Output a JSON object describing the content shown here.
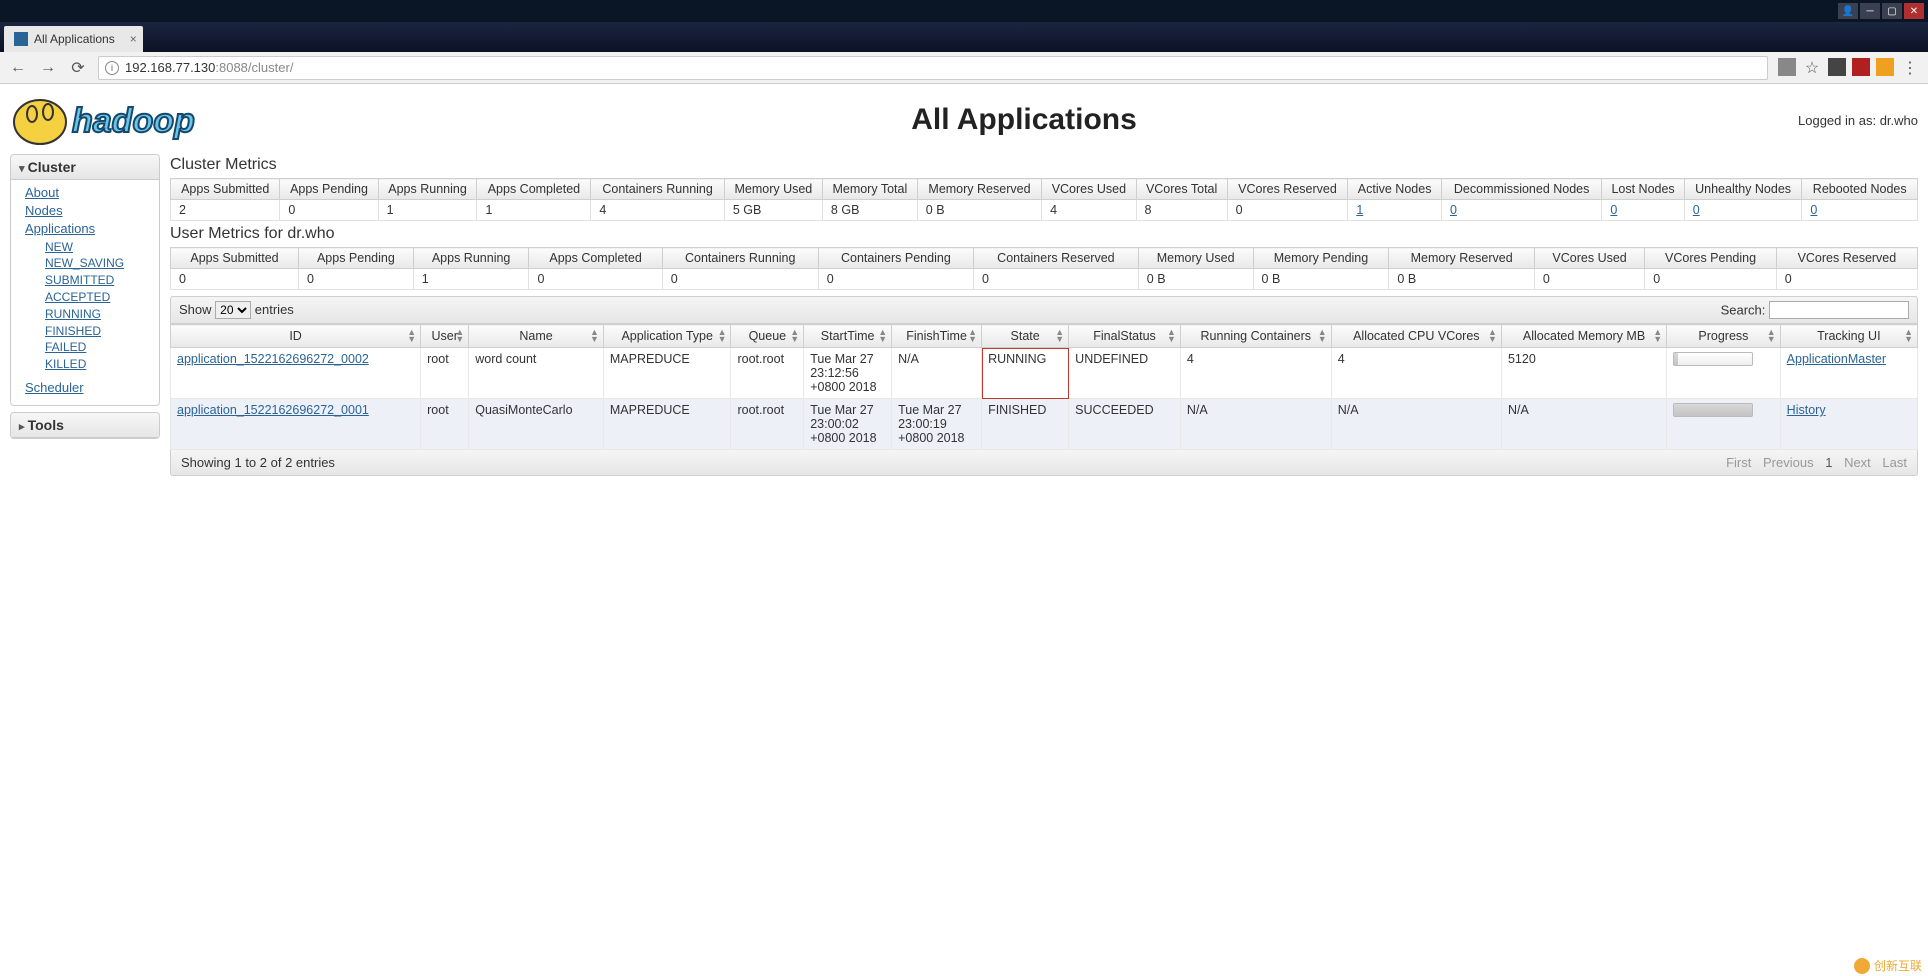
{
  "window": {
    "title": "All Applications"
  },
  "browser": {
    "tab_title": "All Applications",
    "url_host": "192.168.77.130",
    "url_port": ":8088",
    "url_path": "/cluster/"
  },
  "header": {
    "logo_text": "hadoop",
    "page_title": "All Applications",
    "logged_in_label": "Logged in as: ",
    "logged_in_user": "dr.who"
  },
  "sidebar": {
    "cluster": {
      "title": "Cluster",
      "links": {
        "about": "About",
        "nodes": "Nodes",
        "applications": "Applications",
        "scheduler": "Scheduler"
      },
      "app_states": {
        "new": "NEW",
        "new_saving": "NEW_SAVING",
        "submitted": "SUBMITTED",
        "accepted": "ACCEPTED",
        "running": "RUNNING",
        "finished": "FINISHED",
        "failed": "FAILED",
        "killed": "KILLED"
      }
    },
    "tools": {
      "title": "Tools"
    }
  },
  "cluster_metrics": {
    "title": "Cluster Metrics",
    "headers": {
      "apps_submitted": "Apps Submitted",
      "apps_pending": "Apps Pending",
      "apps_running": "Apps Running",
      "apps_completed": "Apps Completed",
      "containers_running": "Containers Running",
      "memory_used": "Memory Used",
      "memory_total": "Memory Total",
      "memory_reserved": "Memory Reserved",
      "vcores_used": "VCores Used",
      "vcores_total": "VCores Total",
      "vcores_reserved": "VCores Reserved",
      "active_nodes": "Active Nodes",
      "decom_nodes": "Decommissioned Nodes",
      "lost_nodes": "Lost Nodes",
      "unhealthy_nodes": "Unhealthy Nodes",
      "rebooted_nodes": "Rebooted Nodes"
    },
    "values": {
      "apps_submitted": "2",
      "apps_pending": "0",
      "apps_running": "1",
      "apps_completed": "1",
      "containers_running": "4",
      "memory_used": "5 GB",
      "memory_total": "8 GB",
      "memory_reserved": "0 B",
      "vcores_used": "4",
      "vcores_total": "8",
      "vcores_reserved": "0",
      "active_nodes": "1",
      "decom_nodes": "0",
      "lost_nodes": "0",
      "unhealthy_nodes": "0",
      "rebooted_nodes": "0"
    }
  },
  "user_metrics": {
    "title": "User Metrics for dr.who",
    "headers": {
      "apps_submitted": "Apps Submitted",
      "apps_pending": "Apps Pending",
      "apps_running": "Apps Running",
      "apps_completed": "Apps Completed",
      "containers_running": "Containers Running",
      "containers_pending": "Containers Pending",
      "containers_reserved": "Containers Reserved",
      "memory_used": "Memory Used",
      "memory_pending": "Memory Pending",
      "memory_reserved": "Memory Reserved",
      "vcores_used": "VCores Used",
      "vcores_pending": "VCores Pending",
      "vcores_reserved": "VCores Reserved"
    },
    "values": {
      "apps_submitted": "0",
      "apps_pending": "0",
      "apps_running": "1",
      "apps_completed": "0",
      "containers_running": "0",
      "containers_pending": "0",
      "containers_reserved": "0",
      "memory_used": "0 B",
      "memory_pending": "0 B",
      "memory_reserved": "0 B",
      "vcores_used": "0",
      "vcores_pending": "0",
      "vcores_reserved": "0"
    }
  },
  "apps_table": {
    "toolbar": {
      "show_label": "Show",
      "entries_label": "entries",
      "length_value": "20",
      "search_label": "Search:"
    },
    "columns": {
      "id": "ID",
      "user": "User",
      "name": "Name",
      "app_type": "Application Type",
      "queue": "Queue",
      "start": "StartTime",
      "finish": "FinishTime",
      "state": "State",
      "final": "FinalStatus",
      "run_cont": "Running Containers",
      "alloc_cpu": "Allocated CPU VCores",
      "alloc_mem": "Allocated Memory MB",
      "progress": "Progress",
      "tracking": "Tracking UI"
    },
    "rows": [
      {
        "id": "application_1522162696272_0002",
        "user": "root",
        "name": "word count",
        "app_type": "MAPREDUCE",
        "queue": "root.root",
        "start": "Tue Mar 27 23:12:56 +0800 2018",
        "finish": "N/A",
        "state": "RUNNING",
        "final": "UNDEFINED",
        "run_cont": "4",
        "alloc_cpu": "4",
        "alloc_mem": "5120",
        "progress_pct": 5,
        "tracking": "ApplicationMaster"
      },
      {
        "id": "application_1522162696272_0001",
        "user": "root",
        "name": "QuasiMonteCarlo",
        "app_type": "MAPREDUCE",
        "queue": "root.root",
        "start": "Tue Mar 27 23:00:02 +0800 2018",
        "finish": "Tue Mar 27 23:00:19 +0800 2018",
        "state": "FINISHED",
        "final": "SUCCEEDED",
        "run_cont": "N/A",
        "alloc_cpu": "N/A",
        "alloc_mem": "N/A",
        "progress_pct": 100,
        "tracking": "History"
      }
    ],
    "footer": {
      "info": "Showing 1 to 2 of 2 entries",
      "first": "First",
      "previous": "Previous",
      "page": "1",
      "next": "Next",
      "last": "Last"
    }
  },
  "watermark": "创新互联"
}
